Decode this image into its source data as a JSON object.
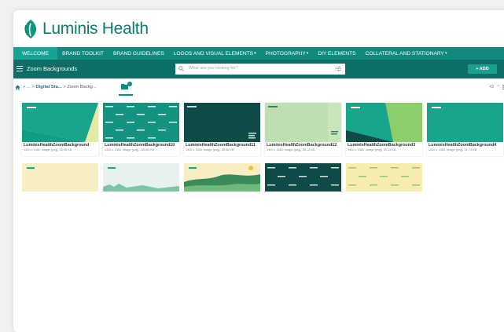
{
  "brand": {
    "name": "Luminis Health",
    "color": "#0e7b6e"
  },
  "nav": {
    "items": [
      {
        "label": "WELCOME",
        "active": true,
        "caret": false
      },
      {
        "label": "BRAND TOOLKIT",
        "caret": false
      },
      {
        "label": "BRAND GUIDELINES",
        "caret": false
      },
      {
        "label": "LOGOS AND VISUAL ELEMENTS",
        "caret": true
      },
      {
        "label": "PHOTOGRAPHY",
        "caret": true
      },
      {
        "label": "DIY ELEMENTS",
        "caret": false
      },
      {
        "label": "COLLATERAL AND STATIONARY",
        "caret": true
      }
    ]
  },
  "subbar": {
    "title": "Zoom Backgrounds",
    "search_placeholder": "What are you looking for?",
    "help": "?",
    "add_label": "+ ADD"
  },
  "breadcrumb": {
    "sep": ">",
    "ellipsis": "...",
    "parent": "Digital Sta...",
    "current": "Zoom Backg..."
  },
  "toolbar": {
    "count": "42",
    "sort_caret": "^"
  },
  "cards": [
    {
      "name": "LuminisHealthZoomBackground",
      "meta": "1920 x 1080, Image (png), 33.98 KB",
      "style": "split"
    },
    {
      "name": "LuminisHealthZoomBackground10",
      "meta": "1920 x 1080, Image (png), 169.63 KB",
      "style": "pattern"
    },
    {
      "name": "LuminisHealthZoomBackground11",
      "meta": "1920 x 1080, Image (png), 38.98 KB",
      "style": "dark"
    },
    {
      "name": "LuminisHealthZoomBackground12",
      "meta": "1920 x 1080, Image (png), 38.12 KB",
      "style": "light"
    },
    {
      "name": "LuminisHealthZoomBackground3",
      "meta": "1920 x 1080, Image (png), 35.13 KB",
      "style": "angled"
    },
    {
      "name": "LuminisHealthZoomBackground4",
      "meta": "1920 x 1080, Image (png), 21.73 KB",
      "style": "teal"
    }
  ],
  "partial_cards": [
    {
      "style": "cream"
    },
    {
      "style": "mint"
    },
    {
      "style": "illustration"
    },
    {
      "style": "dark-pattern"
    },
    {
      "style": "yellow-pattern"
    }
  ]
}
